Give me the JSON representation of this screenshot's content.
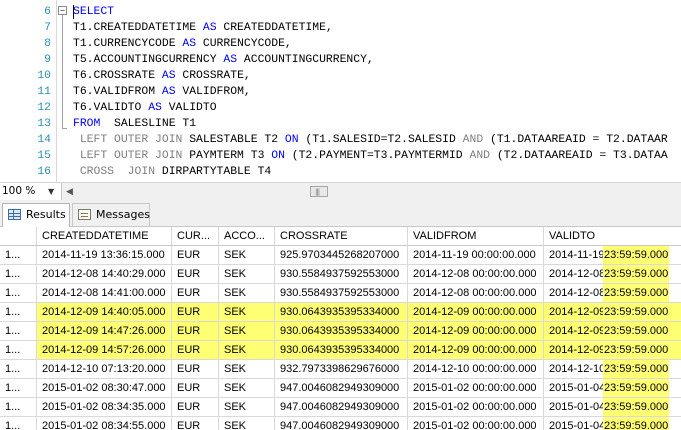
{
  "editor": {
    "lines": [
      {
        "num": "6",
        "tokens": [
          {
            "t": "SELECT",
            "c": "kw"
          }
        ]
      },
      {
        "num": "7",
        "tokens": [
          {
            "t": "T1.CREATEDDATETIME ",
            "c": ""
          },
          {
            "t": "AS",
            "c": "kw"
          },
          {
            "t": " CREATEDDATETIME,",
            "c": ""
          }
        ]
      },
      {
        "num": "8",
        "tokens": [
          {
            "t": "T1.CURRENCYCODE ",
            "c": ""
          },
          {
            "t": "AS",
            "c": "kw"
          },
          {
            "t": " CURRENCYCODE,",
            "c": ""
          }
        ]
      },
      {
        "num": "9",
        "tokens": [
          {
            "t": "T5.ACCOUNTINGCURRENCY ",
            "c": ""
          },
          {
            "t": "AS",
            "c": "kw"
          },
          {
            "t": " ACCOUNTINGCURRENCY,",
            "c": ""
          }
        ]
      },
      {
        "num": "10",
        "tokens": [
          {
            "t": "T6.CROSSRATE ",
            "c": ""
          },
          {
            "t": "AS",
            "c": "kw"
          },
          {
            "t": " CROSSRATE,",
            "c": ""
          }
        ]
      },
      {
        "num": "11",
        "tokens": [
          {
            "t": "T6.VALIDFROM ",
            "c": ""
          },
          {
            "t": "AS",
            "c": "kw"
          },
          {
            "t": " VALIDFROM,",
            "c": ""
          }
        ]
      },
      {
        "num": "12",
        "tokens": [
          {
            "t": "T6.VALIDTO ",
            "c": ""
          },
          {
            "t": "AS",
            "c": "kw"
          },
          {
            "t": " VALIDTO",
            "c": ""
          }
        ]
      },
      {
        "num": "13",
        "tokens": [
          {
            "t": "FROM",
            "c": "kw"
          },
          {
            "t": "  SALESLINE T1",
            "c": ""
          }
        ]
      },
      {
        "num": "14",
        "tokens": [
          {
            "t": " LEFT OUTER JOIN",
            "c": "kg"
          },
          {
            "t": " SALESTABLE T2 ",
            "c": ""
          },
          {
            "t": "ON",
            "c": "kw"
          },
          {
            "t": " (T1.SALESID=T2.SALESID ",
            "c": ""
          },
          {
            "t": "AND",
            "c": "kg"
          },
          {
            "t": " (T1.DATAAREAID = T2.DATAAR",
            "c": ""
          }
        ]
      },
      {
        "num": "15",
        "tokens": [
          {
            "t": " LEFT OUTER JOIN",
            "c": "kg"
          },
          {
            "t": " PAYMTERM T3 ",
            "c": ""
          },
          {
            "t": "ON",
            "c": "kw"
          },
          {
            "t": " (T2.PAYMENT=T3.PAYMTERMID ",
            "c": ""
          },
          {
            "t": "AND",
            "c": "kg"
          },
          {
            "t": " (T2.DATAAREAID = T3.DATAA",
            "c": ""
          }
        ]
      },
      {
        "num": "16",
        "tokens": [
          {
            "t": " CROSS  JOIN",
            "c": "kg"
          },
          {
            "t": " DIRPARTYTABLE T4",
            "c": ""
          }
        ]
      }
    ],
    "fold_symbol": "−"
  },
  "scrollbar": {
    "zoom": "100 %",
    "zoom_arrow": "▼",
    "left_arrow": "◀",
    "grip": "|||"
  },
  "tabs": {
    "results": "Results",
    "messages": "Messages"
  },
  "grid": {
    "columns": [
      "",
      "CREATEDDATETIME",
      "CUR...",
      "ACCO...",
      "CROSSRATE",
      "VALIDFROM",
      "VALIDTO"
    ],
    "rows": [
      {
        "n": "1...",
        "created": "2014-11-19 13:36:15.000",
        "cur": "EUR",
        "acc": "SEK",
        "rate": "925.9703445268207000",
        "from": "2014-11-19 00:00:00.000",
        "to_date": "2014-11-19",
        "to_time": "23:59:59.000",
        "hl": false
      },
      {
        "n": "1...",
        "created": "2014-12-08 14:40:29.000",
        "cur": "EUR",
        "acc": "SEK",
        "rate": "930.5584937592553000",
        "from": "2014-12-08 00:00:00.000",
        "to_date": "2014-12-08",
        "to_time": "23:59:59.000",
        "hl": false
      },
      {
        "n": "1...",
        "created": "2014-12-08 14:41:00.000",
        "cur": "EUR",
        "acc": "SEK",
        "rate": "930.5584937592553000",
        "from": "2014-12-08 00:00:00.000",
        "to_date": "2014-12-08",
        "to_time": "23:59:59.000",
        "hl": false
      },
      {
        "n": "1...",
        "created": "2014-12-09 14:40:05.000",
        "cur": "EUR",
        "acc": "SEK",
        "rate": "930.0643935395334000",
        "from": "2014-12-09 00:00:00.000",
        "to_date": "2014-12-09",
        "to_time": "23:59:59.000",
        "hl": true
      },
      {
        "n": "1...",
        "created": "2014-12-09 14:47:26.000",
        "cur": "EUR",
        "acc": "SEK",
        "rate": "930.0643935395334000",
        "from": "2014-12-09 00:00:00.000",
        "to_date": "2014-12-09",
        "to_time": "23:59:59.000",
        "hl": true
      },
      {
        "n": "1...",
        "created": "2014-12-09 14:57:26.000",
        "cur": "EUR",
        "acc": "SEK",
        "rate": "930.0643935395334000",
        "from": "2014-12-09 00:00:00.000",
        "to_date": "2014-12-09",
        "to_time": "23:59:59.000",
        "hl": true
      },
      {
        "n": "1...",
        "created": "2014-12-10 07:13:20.000",
        "cur": "EUR",
        "acc": "SEK",
        "rate": "932.7973398629676000",
        "from": "2014-12-10 00:00:00.000",
        "to_date": "2014-12-10",
        "to_time": "23:59:59.000",
        "hl": false
      },
      {
        "n": "1...",
        "created": "2015-01-02 08:30:47.000",
        "cur": "EUR",
        "acc": "SEK",
        "rate": "947.0046082949309000",
        "from": "2015-01-02 00:00:00.000",
        "to_date": "2015-01-04",
        "to_time": "23:59:59.000",
        "hl": false
      },
      {
        "n": "1...",
        "created": "2015-01-02 08:34:35.000",
        "cur": "EUR",
        "acc": "SEK",
        "rate": "947.0046082949309000",
        "from": "2015-01-02 00:00:00.000",
        "to_date": "2015-01-04",
        "to_time": "23:59:59.000",
        "hl": false
      },
      {
        "n": "1...",
        "created": "2015-01-02 08:34:55.000",
        "cur": "EUR",
        "acc": "SEK",
        "rate": "947.0046082949309000",
        "from": "2015-01-02 00:00:00.000",
        "to_date": "2015-01-04",
        "to_time": "23:59:59.000",
        "hl": false
      }
    ]
  },
  "colors": {
    "highlight": "#ffff73",
    "keyword": "#0000ff",
    "keyword_gray": "#808080",
    "line_number": "#2b91af"
  }
}
